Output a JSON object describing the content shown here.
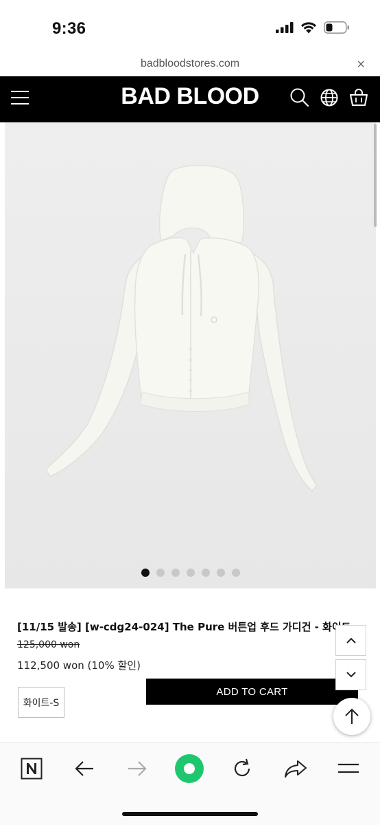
{
  "status_bar": {
    "time": "9:36"
  },
  "url_bar": {
    "url": "badbloodstores.com",
    "close_label": "×"
  },
  "header": {
    "brand": "BAD BLOOD"
  },
  "gallery": {
    "slide_count": 7,
    "active_slide": 1
  },
  "product": {
    "title": "[11/15 발송] [w-cdg24-024] The Pure 버튼업 후드 가디건 - 화이트",
    "original_price": "125,000 won",
    "sale_price": "112,500 won (10% 할인)",
    "selected_option": "화이트-S",
    "add_to_cart_label": "ADD TO CART"
  },
  "colors": {
    "header_bg": "#000000",
    "accent_green": "#1ec76e",
    "image_bg": "#ececec"
  },
  "toolbar": {
    "icons": [
      "n-icon",
      "back-arrow-icon",
      "forward-arrow-icon",
      "green-dot-icon",
      "reload-icon",
      "share-icon",
      "menu-icon"
    ]
  }
}
